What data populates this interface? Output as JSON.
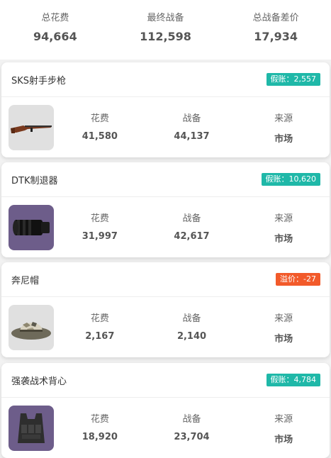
{
  "summary": [
    {
      "label": "总花费",
      "value": "94,664"
    },
    {
      "label": "最终战备",
      "value": "112,598"
    },
    {
      "label": "总战备差价",
      "value": "17,934"
    }
  ],
  "items": [
    {
      "name": "SKS射手步枪",
      "badge": "假账：2,557",
      "badge_color": "#1fb8a8",
      "icon": "rifle-icon",
      "stats": [
        {
          "label": "花费",
          "value": "41,580"
        },
        {
          "label": "战备",
          "value": "44,137"
        },
        {
          "label": "来源",
          "value": "市场"
        }
      ]
    },
    {
      "name": "DTK制退器",
      "badge": "假账：10,620",
      "badge_color": "#1fb8a8",
      "icon": "muzzle-brake-icon",
      "stats": [
        {
          "label": "花费",
          "value": "31,997"
        },
        {
          "label": "战备",
          "value": "42,617"
        },
        {
          "label": "来源",
          "value": "市场"
        }
      ]
    },
    {
      "name": "奔尼帽",
      "badge": "溢价：-27",
      "badge_color": "#f25a2a",
      "icon": "boonie-hat-icon",
      "stats": [
        {
          "label": "花费",
          "value": "2,167"
        },
        {
          "label": "战备",
          "value": "2,140"
        },
        {
          "label": "来源",
          "value": "市场"
        }
      ]
    },
    {
      "name": "强袭战术背心",
      "badge": "假账：4,784",
      "badge_color": "#1fb8a8",
      "icon": "tactical-vest-icon",
      "stats": [
        {
          "label": "花费",
          "value": "18,920"
        },
        {
          "label": "战备",
          "value": "23,704"
        },
        {
          "label": "来源",
          "value": "市场"
        }
      ]
    }
  ]
}
